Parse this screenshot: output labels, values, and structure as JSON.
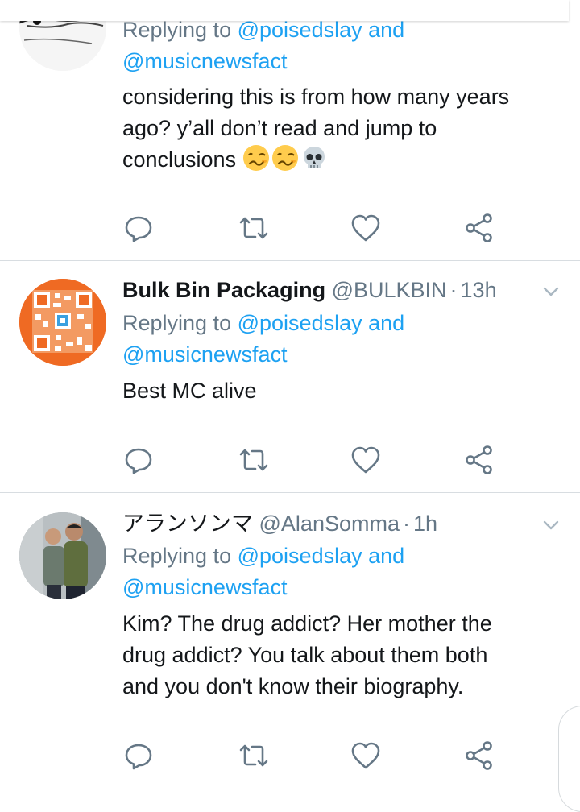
{
  "tweets": [
    {
      "reply_prefix": "Replying to",
      "mention1": "@poisedslay",
      "and": "and",
      "mention2": "@musicnewsfact",
      "body_lines": [
        "considering this is from how many years",
        "ago? y’all don’t read and jump to",
        "conclusions"
      ],
      "emojis": [
        "woozy-face",
        "woozy-face",
        "skull"
      ]
    },
    {
      "name": "Bulk Bin Packaging",
      "handle": "@BULKBIN",
      "separator": "·",
      "time": "13h",
      "reply_prefix": "Replying to",
      "mention1": "@poisedslay",
      "and": "and",
      "mention2": "@musicnewsfact",
      "body_lines": [
        "Best MC alive"
      ]
    },
    {
      "name": "アランソンマ",
      "handle": "@AlanSomma",
      "separator": "·",
      "time": "1h",
      "reply_prefix": "Replying to",
      "mention1": "@poisedslay",
      "and": "and",
      "mention2": "@musicnewsfact",
      "body_lines": [
        "Kim? The drug addict? Her mother the",
        "drug addict? You talk about them both",
        "and you don't know their biography."
      ]
    }
  ],
  "action_icons": [
    "reply-icon",
    "retweet-icon",
    "like-icon",
    "share-icon"
  ],
  "colors": {
    "mention": "#1da1f2",
    "secondary": "#657786",
    "text": "#14171a",
    "divider": "#d8dde1"
  }
}
